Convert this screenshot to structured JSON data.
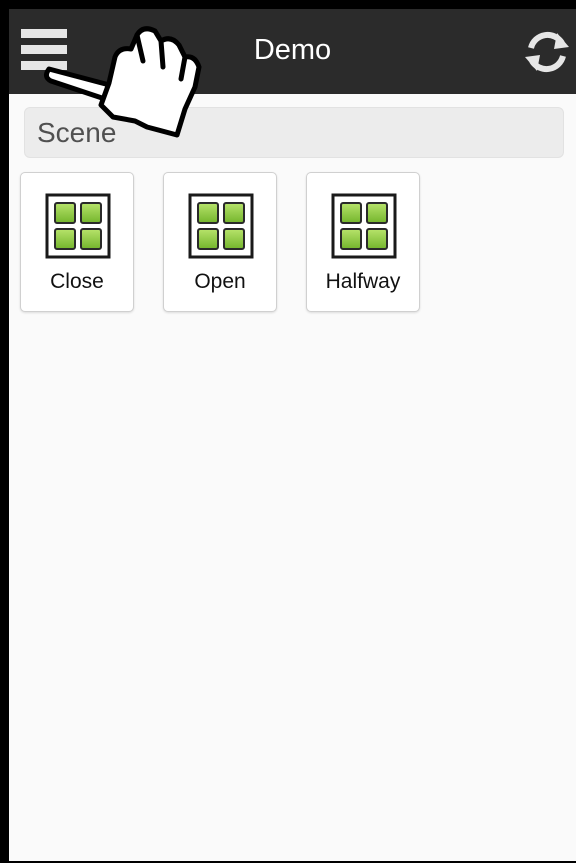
{
  "header": {
    "title": "Demo",
    "menu_icon": "hamburger-menu-icon",
    "refresh_icon": "refresh-icon",
    "background": "#2b2b2b"
  },
  "scene_section": {
    "label": "Scene"
  },
  "scenes": [
    {
      "label": "Close",
      "icon": "scene-grid-icon"
    },
    {
      "label": "Open",
      "icon": "scene-grid-icon"
    },
    {
      "label": "Halfway",
      "icon": "scene-grid-icon"
    }
  ],
  "colors": {
    "tile_square_green": "#8ac840",
    "content_background": "#fafafa"
  },
  "cursor": {
    "icon": "hand-pointer-cursor-icon"
  }
}
